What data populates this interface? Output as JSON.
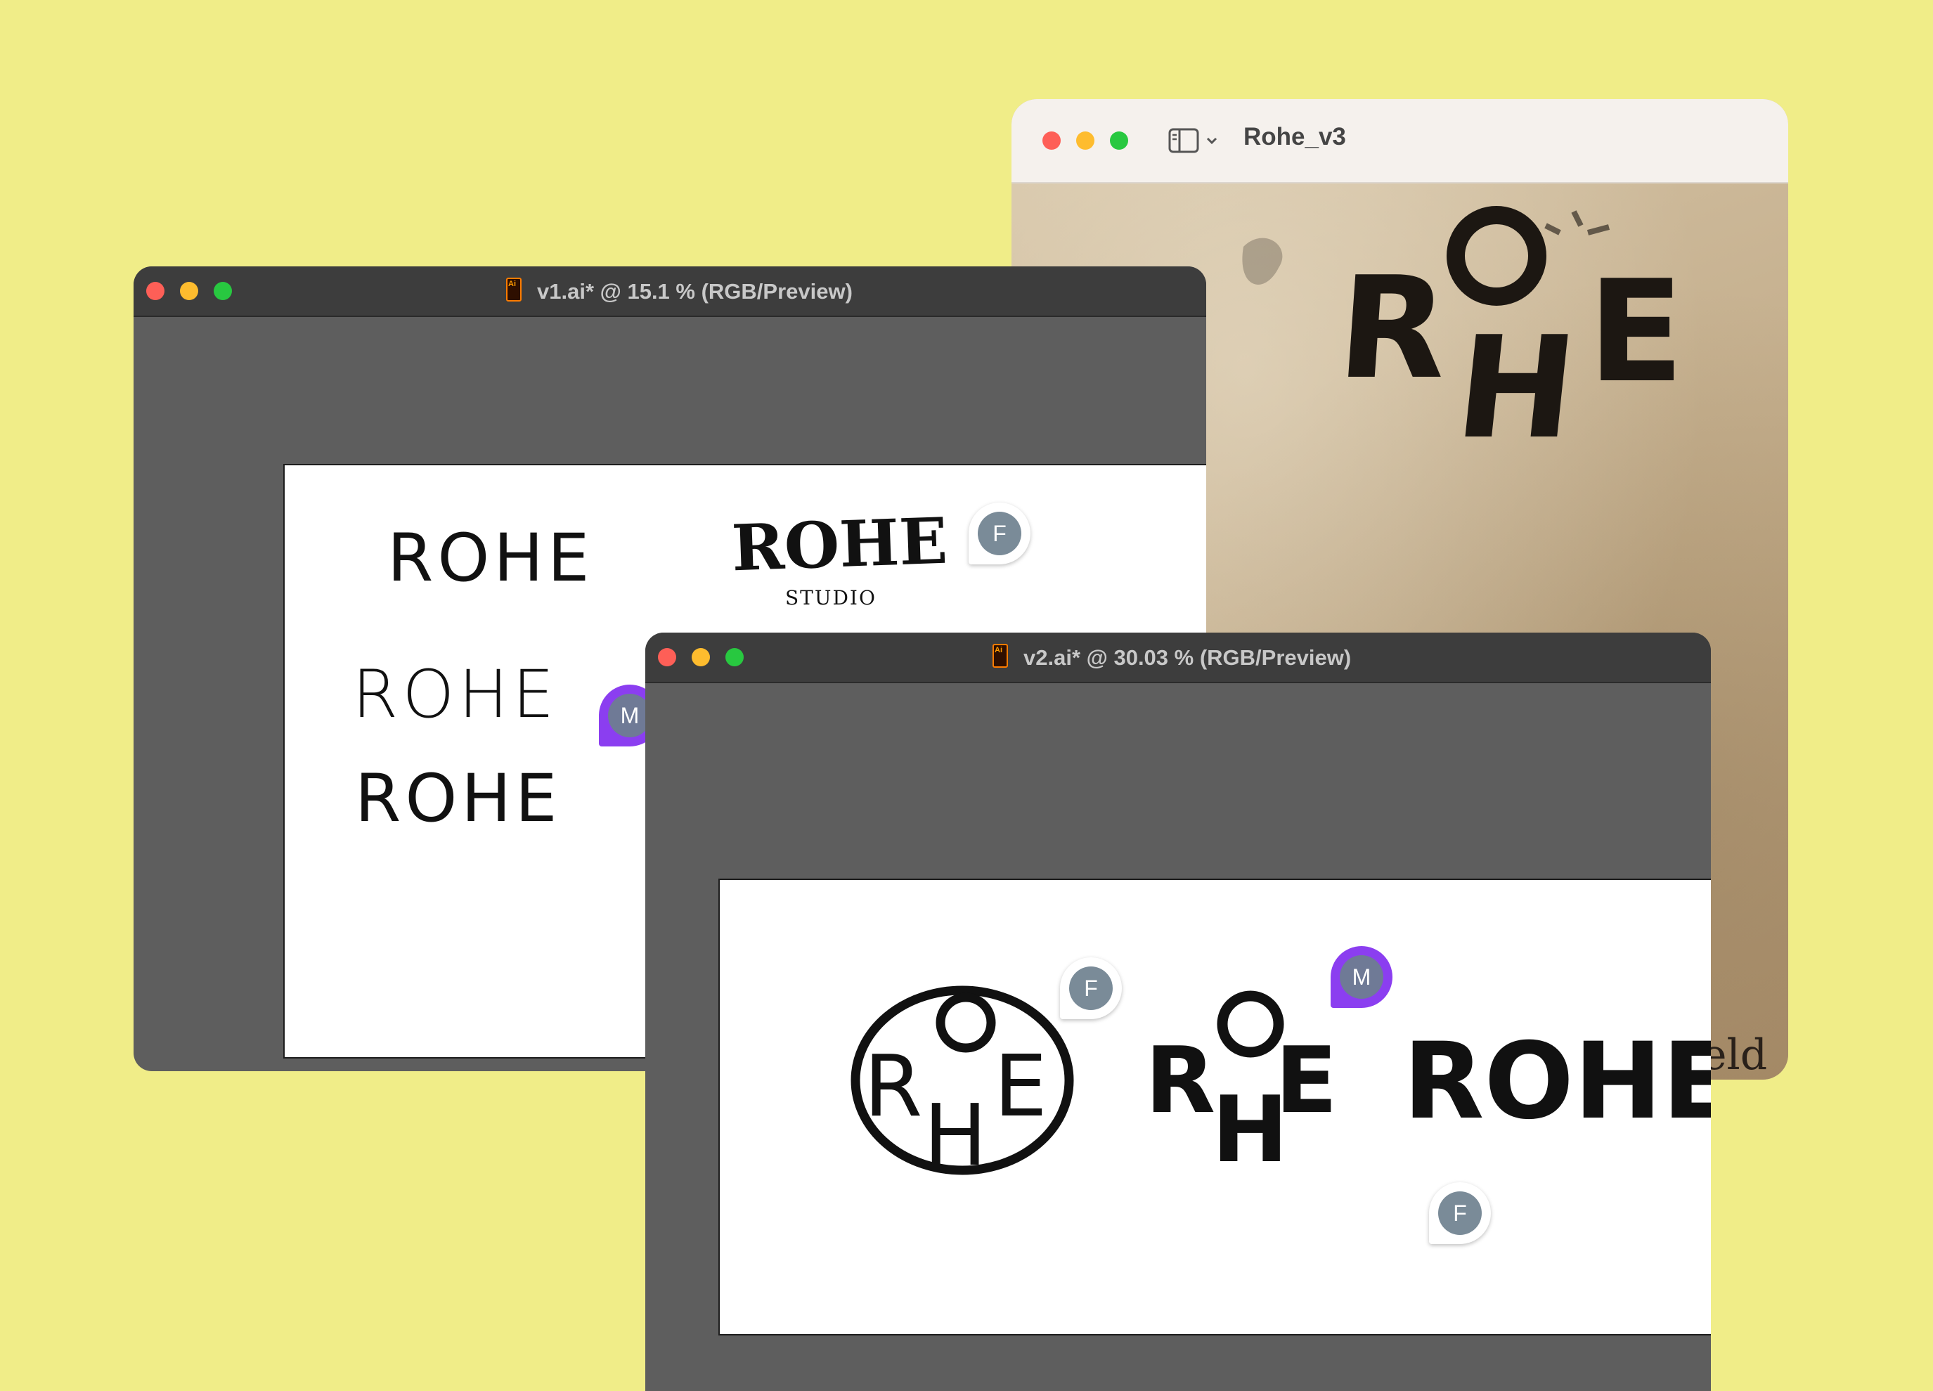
{
  "preview_window": {
    "title": "Rohe_v3",
    "stamp_text": "ROHE",
    "corner_text": "eld"
  },
  "v1_window": {
    "title": "v1.ai* @ 15.1 % (RGB/Preview)",
    "app_badge": "Ai",
    "wordmarks": [
      "ROHE",
      "ROHE",
      "ROHE",
      "ROHE"
    ],
    "studio_label": "STUDIO",
    "comments": [
      "F",
      "M"
    ]
  },
  "v2_window": {
    "title": "v2.ai* @ 30.03 % (RGB/Preview)",
    "app_badge": "Ai",
    "wordmarks": [
      "ROHE",
      "ROHE",
      "ROHE"
    ],
    "comments": [
      "F",
      "M",
      "F"
    ]
  },
  "colors": {
    "background": "#f0ed88",
    "comment_accent": "#8b3ef0",
    "avatar": "#7a8b98"
  }
}
